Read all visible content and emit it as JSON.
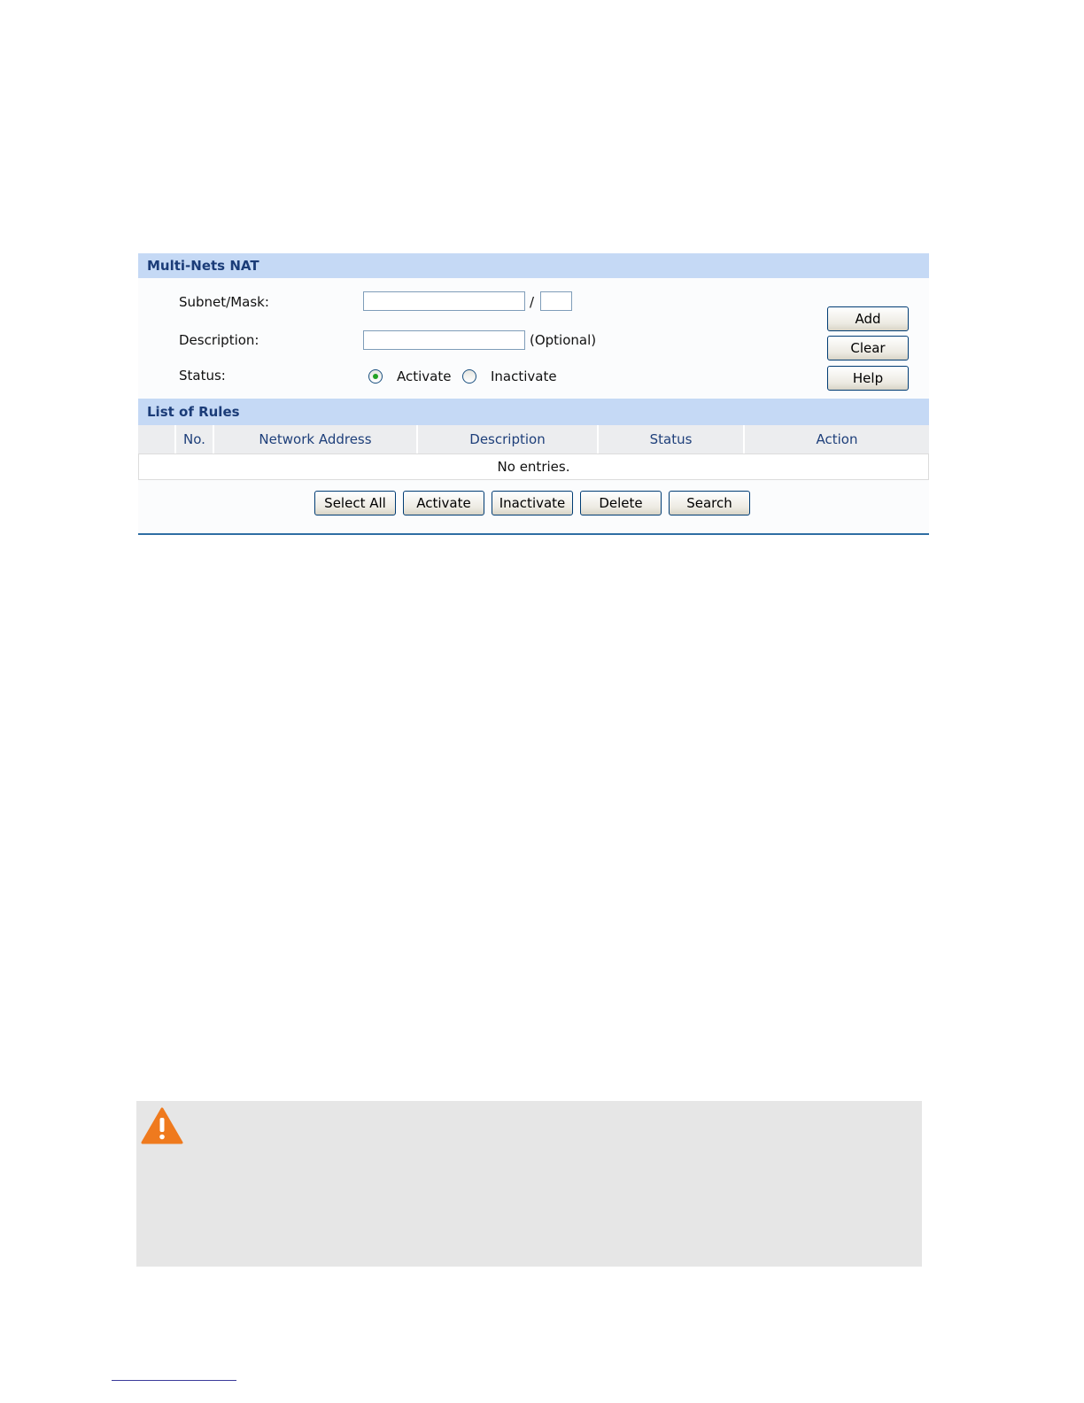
{
  "panel": {
    "title": "Multi-Nets NAT",
    "form": {
      "subnet_label": "Subnet/Mask:",
      "subnet_value": "",
      "mask_separator": "/",
      "mask_value": "",
      "description_label": "Description:",
      "description_value": "",
      "description_hint": "(Optional)",
      "status_label": "Status:",
      "status_options": [
        {
          "label": "Activate",
          "selected": true
        },
        {
          "label": "Inactivate",
          "selected": false
        }
      ]
    },
    "side_buttons": {
      "add": "Add",
      "clear": "Clear",
      "help": "Help"
    }
  },
  "rules": {
    "title": "List of Rules",
    "columns": [
      "",
      "No.",
      "Network Address",
      "Description",
      "Status",
      "Action"
    ],
    "empty_text": "No entries.",
    "buttons": {
      "select_all": "Select All",
      "activate": "Activate",
      "inactivate": "Inactivate",
      "delete": "Delete",
      "search": "Search"
    }
  },
  "warning": {
    "icon": "warning-triangle-icon",
    "color": "#ef7a1e"
  }
}
